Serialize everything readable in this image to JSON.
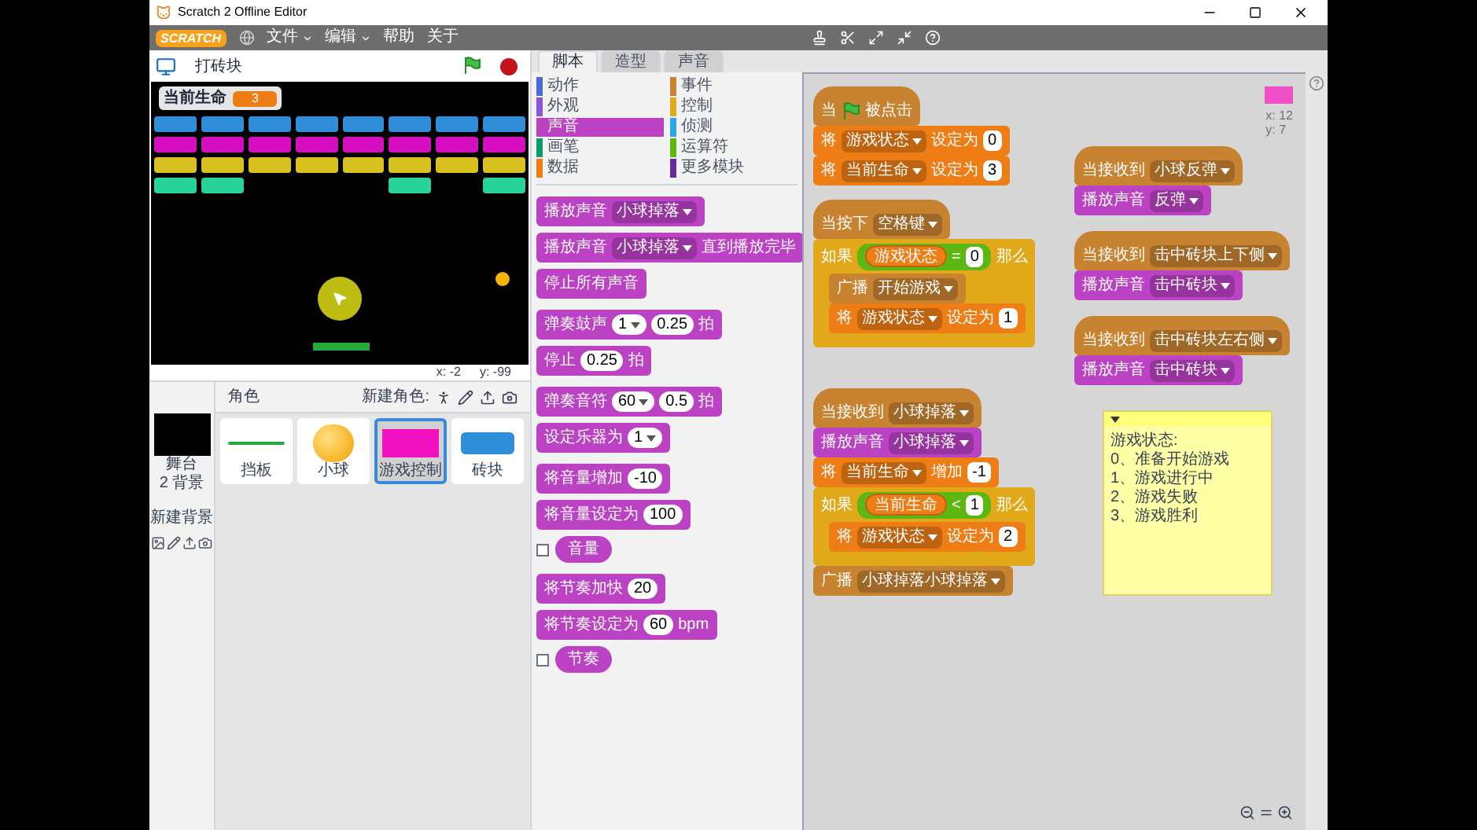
{
  "window": {
    "title": "Scratch 2 Offline Editor"
  },
  "menu": {
    "logo": "SCRATCH",
    "items": [
      {
        "label": "文件",
        "kind": "dropdown"
      },
      {
        "label": "编辑",
        "kind": "dropdown"
      },
      {
        "label": "帮助",
        "kind": "plain"
      },
      {
        "label": "关于",
        "kind": "plain"
      }
    ]
  },
  "stage": {
    "title": "打砖块",
    "monitor": {
      "label": "当前生命",
      "value": "3"
    },
    "bricks": [
      {
        "color": "#2e8fd8",
        "cells": [
          true,
          true,
          true,
          true,
          true,
          true,
          true,
          true
        ]
      },
      {
        "color": "#d50fbf",
        "cells": [
          true,
          true,
          true,
          true,
          true,
          true,
          true,
          true
        ]
      },
      {
        "color": "#d8c021",
        "cells": [
          true,
          true,
          true,
          true,
          true,
          true,
          true,
          true
        ]
      },
      {
        "color": "#27d39a",
        "cells": [
          true,
          true,
          false,
          false,
          false,
          true,
          false,
          true
        ]
      }
    ],
    "mouse_x": "x: -2",
    "mouse_y": "y: -99"
  },
  "sprites": {
    "header": "角色",
    "new_sprite_label": "新建角色:",
    "stage_item": {
      "name": "舞台",
      "subtitle": "2 背景"
    },
    "new_backdrop_label": "新建背景",
    "items": [
      {
        "name": "挡板",
        "kind": "paddle",
        "selected": false
      },
      {
        "name": "小球",
        "kind": "ball",
        "selected": false
      },
      {
        "name": "游戏控制",
        "kind": "panel",
        "selected": true
      },
      {
        "name": "砖块",
        "kind": "brick",
        "selected": false
      }
    ]
  },
  "tabs": [
    {
      "label": "脚本",
      "selected": true
    },
    {
      "label": "造型",
      "selected": false
    },
    {
      "label": "声音",
      "selected": false
    }
  ],
  "palette": {
    "categories": [
      {
        "label": "动作",
        "color": "#4a6cd4",
        "selected": false
      },
      {
        "label": "事件",
        "color": "#c88330",
        "selected": false
      },
      {
        "label": "外观",
        "color": "#8a55d7",
        "selected": false
      },
      {
        "label": "控制",
        "color": "#e1a91a",
        "selected": false
      },
      {
        "label": "声音",
        "color": "#bb42c3",
        "selected": true
      },
      {
        "label": "侦测",
        "color": "#2ca5e2",
        "selected": false
      },
      {
        "label": "画笔",
        "color": "#0e9a6c",
        "selected": false
      },
      {
        "label": "运算符",
        "color": "#5cb712",
        "selected": false
      },
      {
        "label": "数据",
        "color": "#ee7d16",
        "selected": false
      },
      {
        "label": "更多模块",
        "color": "#632d99",
        "selected": false
      }
    ],
    "groups": [
      [
        {
          "kind": "stack",
          "color": "#bb42c3",
          "parts": [
            {
              "kind": "text",
              "text": "播放声音"
            },
            {
              "kind": "dropdown",
              "text": "小球掉落"
            }
          ]
        },
        {
          "kind": "stack",
          "color": "#bb42c3",
          "parts": [
            {
              "kind": "text",
              "text": "播放声音"
            },
            {
              "kind": "dropdown",
              "text": "小球掉落"
            },
            {
              "kind": "text",
              "text": "直到播放完毕"
            }
          ]
        },
        {
          "kind": "stack",
          "color": "#bb42c3",
          "parts": [
            {
              "kind": "text",
              "text": "停止所有声音"
            }
          ]
        }
      ],
      [
        {
          "kind": "stack",
          "color": "#bb42c3",
          "parts": [
            {
              "kind": "text",
              "text": "弹奏鼓声"
            },
            {
              "kind": "round_dropdown",
              "text": "1"
            },
            {
              "kind": "round",
              "text": "0.25"
            },
            {
              "kind": "text",
              "text": "拍"
            }
          ]
        },
        {
          "kind": "stack",
          "color": "#bb42c3",
          "parts": [
            {
              "kind": "text",
              "text": "停止"
            },
            {
              "kind": "round",
              "text": "0.25"
            },
            {
              "kind": "text",
              "text": "拍"
            }
          ]
        }
      ],
      [
        {
          "kind": "stack",
          "color": "#bb42c3",
          "parts": [
            {
              "kind": "text",
              "text": "弹奏音符"
            },
            {
              "kind": "round_dropdown",
              "text": "60"
            },
            {
              "kind": "round",
              "text": "0.5"
            },
            {
              "kind": "text",
              "text": "拍"
            }
          ]
        },
        {
          "kind": "stack",
          "color": "#bb42c3",
          "parts": [
            {
              "kind": "text",
              "text": "设定乐器为"
            },
            {
              "kind": "round_dropdown",
              "text": "1"
            }
          ]
        }
      ],
      [
        {
          "kind": "stack",
          "color": "#bb42c3",
          "parts": [
            {
              "kind": "text",
              "text": "将音量增加"
            },
            {
              "kind": "round",
              "text": "-10"
            }
          ]
        },
        {
          "kind": "stack",
          "color": "#bb42c3",
          "parts": [
            {
              "kind": "text",
              "text": "将音量设定为"
            },
            {
              "kind": "round",
              "text": "100"
            }
          ]
        },
        {
          "kind": "reporter",
          "color": "#bb42c3",
          "checked": false,
          "parts": [
            {
              "kind": "text",
              "text": "音量"
            }
          ]
        }
      ],
      [
        {
          "kind": "stack",
          "color": "#bb42c3",
          "parts": [
            {
              "kind": "text",
              "text": "将节奏加快"
            },
            {
              "kind": "round",
              "text": "20"
            }
          ]
        },
        {
          "kind": "stack",
          "color": "#bb42c3",
          "parts": [
            {
              "kind": "text",
              "text": "将节奏设定为"
            },
            {
              "kind": "round",
              "text": "60"
            },
            {
              "kind": "text",
              "text": "bpm"
            }
          ]
        },
        {
          "kind": "reporter",
          "color": "#bb42c3",
          "checked": false,
          "parts": [
            {
              "kind": "text",
              "text": "节奏"
            }
          ]
        }
      ]
    ]
  },
  "scripts": {
    "x": "x: 12",
    "y": "y: 7",
    "list": [
      {
        "blocks": [
          {
            "kind": "hat",
            "color": "#c88330",
            "parts": [
              {
                "kind": "text",
                "text": "当"
              },
              {
                "kind": "flag"
              },
              {
                "kind": "text",
                "text": "被点击"
              }
            ]
          },
          {
            "kind": "stack",
            "color": "#ee7d16",
            "parts": [
              {
                "kind": "text",
                "text": "将"
              },
              {
                "kind": "dropdown",
                "text": "游戏状态"
              },
              {
                "kind": "text",
                "text": "设定为"
              },
              {
                "kind": "number",
                "text": "0"
              }
            ]
          },
          {
            "kind": "stack",
            "color": "#ee7d16",
            "parts": [
              {
                "kind": "text",
                "text": "将"
              },
              {
                "kind": "dropdown",
                "text": "当前生命"
              },
              {
                "kind": "text",
                "text": "设定为"
              },
              {
                "kind": "number",
                "text": "3"
              }
            ]
          }
        ]
      },
      {
        "blocks": [
          {
            "kind": "hat",
            "color": "#c88330",
            "parts": [
              {
                "kind": "text",
                "text": "当按下"
              },
              {
                "kind": "dropdown",
                "text": "空格键"
              }
            ]
          },
          {
            "kind": "if",
            "color": "#e1a91a",
            "parts": [
              {
                "kind": "text",
                "text": "如果"
              },
              {
                "kind": "bool",
                "parts": [
                  {
                    "kind": "var",
                    "text": "游戏状态"
                  },
                  {
                    "kind": "text",
                    "text": "="
                  },
                  {
                    "kind": "number",
                    "text": "0"
                  }
                ]
              },
              {
                "kind": "text",
                "text": "那么"
              }
            ],
            "children": [
              {
                "kind": "stack",
                "color": "#c88330",
                "parts": [
                  {
                    "kind": "text",
                    "text": "广播"
                  },
                  {
                    "kind": "dropdown",
                    "text": "开始游戏"
                  }
                ]
              },
              {
                "kind": "stack",
                "color": "#ee7d16",
                "parts": [
                  {
                    "kind": "text",
                    "text": "将"
                  },
                  {
                    "kind": "dropdown",
                    "text": "游戏状态"
                  },
                  {
                    "kind": "text",
                    "text": "设定为"
                  },
                  {
                    "kind": "number",
                    "text": "1"
                  }
                ]
              }
            ]
          }
        ]
      },
      {
        "blocks": [
          {
            "kind": "hat",
            "color": "#c88330",
            "parts": [
              {
                "kind": "text",
                "text": "当接收到"
              },
              {
                "kind": "dropdown",
                "text": "小球反弹"
              }
            ]
          },
          {
            "kind": "stack",
            "color": "#bb42c3",
            "parts": [
              {
                "kind": "text",
                "text": "播放声音"
              },
              {
                "kind": "dropdown",
                "text": "反弹"
              }
            ]
          }
        ]
      },
      {
        "blocks": [
          {
            "kind": "hat",
            "color": "#c88330",
            "parts": [
              {
                "kind": "text",
                "text": "当接收到"
              },
              {
                "kind": "dropdown",
                "text": "击中砖块上下侧"
              }
            ]
          },
          {
            "kind": "stack",
            "color": "#bb42c3",
            "parts": [
              {
                "kind": "text",
                "text": "播放声音"
              },
              {
                "kind": "dropdown",
                "text": "击中砖块"
              }
            ]
          }
        ]
      },
      {
        "blocks": [
          {
            "kind": "hat",
            "color": "#c88330",
            "parts": [
              {
                "kind": "text",
                "text": "当接收到"
              },
              {
                "kind": "dropdown",
                "text": "击中砖块左右侧"
              }
            ]
          },
          {
            "kind": "stack",
            "color": "#bb42c3",
            "parts": [
              {
                "kind": "text",
                "text": "播放声音"
              },
              {
                "kind": "dropdown",
                "text": "击中砖块"
              }
            ]
          }
        ]
      },
      {
        "blocks": [
          {
            "kind": "hat",
            "color": "#c88330",
            "parts": [
              {
                "kind": "text",
                "text": "当接收到"
              },
              {
                "kind": "dropdown",
                "text": "小球掉落"
              }
            ]
          },
          {
            "kind": "stack",
            "color": "#bb42c3",
            "parts": [
              {
                "kind": "text",
                "text": "播放声音"
              },
              {
                "kind": "dropdown",
                "text": "小球掉落"
              }
            ]
          },
          {
            "kind": "stack",
            "color": "#ee7d16",
            "parts": [
              {
                "kind": "text",
                "text": "将"
              },
              {
                "kind": "dropdown",
                "text": "当前生命"
              },
              {
                "kind": "text",
                "text": "增加"
              },
              {
                "kind": "number",
                "text": "-1"
              }
            ]
          },
          {
            "kind": "if",
            "color": "#e1a91a",
            "parts": [
              {
                "kind": "text",
                "text": "如果"
              },
              {
                "kind": "bool",
                "parts": [
                  {
                    "kind": "var",
                    "text": "当前生命"
                  },
                  {
                    "kind": "text",
                    "text": "<"
                  },
                  {
                    "kind": "number",
                    "text": "1"
                  }
                ]
              },
              {
                "kind": "text",
                "text": "那么"
              }
            ],
            "children": [
              {
                "kind": "stack",
                "color": "#ee7d16",
                "parts": [
                  {
                    "kind": "text",
                    "text": "将"
                  },
                  {
                    "kind": "dropdown",
                    "text": "游戏状态"
                  },
                  {
                    "kind": "text",
                    "text": "设定为"
                  },
                  {
                    "kind": "number",
                    "text": "2"
                  }
                ]
              }
            ]
          },
          {
            "kind": "stack",
            "color": "#c88330",
            "parts": [
              {
                "kind": "text",
                "text": "广播"
              },
              {
                "kind": "dropdown",
                "text": "小球掉落小球掉落"
              }
            ]
          }
        ]
      }
    ],
    "note": {
      "lines": [
        "游戏状态:",
        "0、准备开始游戏",
        "1、游戏进行中",
        "2、游戏失败",
        "3、游戏胜利"
      ]
    }
  }
}
